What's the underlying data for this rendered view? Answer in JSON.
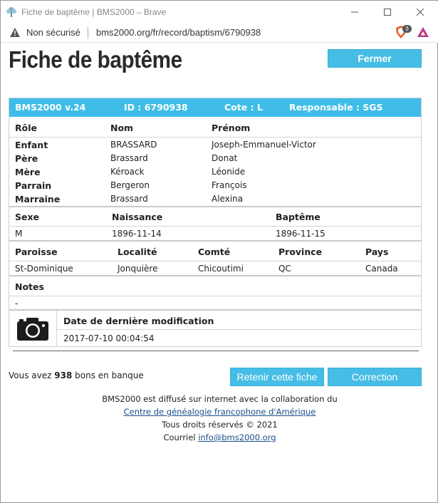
{
  "window": {
    "title": "Fiche de baptême | BMS2000 – Brave"
  },
  "address_bar": {
    "security": "Non sécurisé",
    "url": "bms2000.org/fr/record/baptism/6790938",
    "shield_count": "3"
  },
  "page": {
    "title": "Fiche de baptême",
    "close_button": "Fermer"
  },
  "record": {
    "header": {
      "version": "BMS2000 v.24",
      "id": "ID : 6790938",
      "cote": "Cote : L",
      "responsable": "Responsable : SGS"
    },
    "persons_headers": [
      "Rôle",
      "Nom",
      "Prénom"
    ],
    "persons": [
      {
        "role": "Enfant",
        "nom": "BRASSARD",
        "prenom": "Joseph-Emmanuel-Victor"
      },
      {
        "role": "Père",
        "nom": "Brassard",
        "prenom": "Donat"
      },
      {
        "role": "Mère",
        "nom": "Kéroack",
        "prenom": "Léonide"
      },
      {
        "role": "Parrain",
        "nom": "Bergeron",
        "prenom": "François"
      },
      {
        "role": "Marraine",
        "nom": "Brassard",
        "prenom": "Alexina"
      }
    ],
    "birth_headers": [
      "Sexe",
      "Naissance",
      "Baptême"
    ],
    "birth": {
      "sexe": "M",
      "naissance": "1896-11-14",
      "bapteme": "1896-11-15"
    },
    "place_headers": [
      "Paroisse",
      "Localité",
      "Comté",
      "Province",
      "Pays"
    ],
    "place": {
      "paroisse": "St-Dominique",
      "localite": "Jonquière",
      "comte": "Chicoutimi",
      "province": "QC",
      "pays": "Canada"
    },
    "notes_label": "Notes",
    "notes_value": "-",
    "modified_label": "Date de dernière modification",
    "modified_value": "2017-07-10 00:04:54"
  },
  "bank": {
    "prefix": "Vous avez",
    "count": "938",
    "suffix": "bons en banque"
  },
  "actions": {
    "retain": "Retenir cette fiche",
    "correction": "Correction"
  },
  "footer": {
    "line1": "BMS2000 est diffusé sur internet avec la collaboration du",
    "link": "Centre de généalogie francophone d'Amérique",
    "rights": "Tous droits réservés © 2021",
    "email_label": "Courriel",
    "email": "info@bms2000.org"
  },
  "colors": {
    "accent": "#45bde5",
    "header_bar": "#3fbde8",
    "link": "#1a4f8a"
  }
}
